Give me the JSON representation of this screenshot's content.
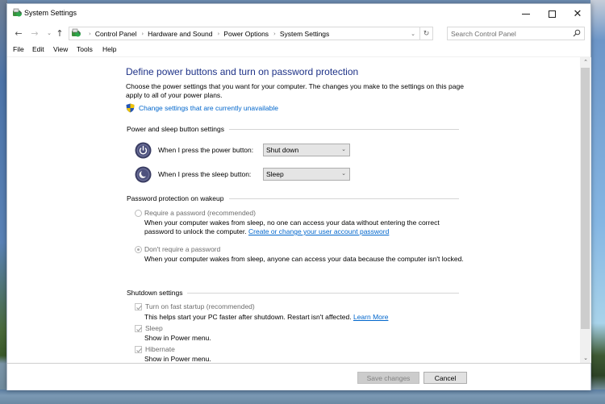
{
  "window": {
    "title": "System Settings",
    "controls": {
      "minimize": "minimize",
      "maximize": "maximize",
      "close": "close"
    }
  },
  "nav": {
    "breadcrumbs": [
      "Control Panel",
      "Hardware and Sound",
      "Power Options",
      "System Settings"
    ],
    "search_placeholder": "Search Control Panel",
    "search_value": ""
  },
  "menu": [
    "File",
    "Edit",
    "View",
    "Tools",
    "Help"
  ],
  "page": {
    "heading": "Define power buttons and turn on password protection",
    "intro": "Choose the power settings that you want for your computer. The changes you make to the settings on this page apply to all of your power plans.",
    "change_settings_link": "Change settings that are currently unavailable"
  },
  "power_section": {
    "title": "Power and sleep button settings",
    "rows": [
      {
        "label": "When I press the power button:",
        "value": "Shut down",
        "icon": "power-icon"
      },
      {
        "label": "When I press the sleep button:",
        "value": "Sleep",
        "icon": "sleep-moon-icon"
      }
    ]
  },
  "password_section": {
    "title": "Password protection on wakeup",
    "options": [
      {
        "label": "Require a password (recommended)",
        "checked": false,
        "description": "When your computer wakes from sleep, no one can access your data without entering the correct password to unlock the computer.",
        "link": "Create or change your user account password"
      },
      {
        "label": "Don't require a password",
        "checked": true,
        "description": "When your computer wakes from sleep, anyone can access your data because the computer isn't locked."
      }
    ]
  },
  "shutdown_section": {
    "title": "Shutdown settings",
    "items": [
      {
        "label": "Turn on fast startup (recommended)",
        "checked": true,
        "description": "This helps start your PC faster after shutdown. Restart isn't affected.",
        "link": "Learn More"
      },
      {
        "label": "Sleep",
        "checked": true,
        "description": "Show in Power menu."
      },
      {
        "label": "Hibernate",
        "checked": true,
        "description": "Show in Power menu."
      }
    ]
  },
  "footer": {
    "save_label": "Save changes",
    "cancel_label": "Cancel"
  },
  "colors": {
    "heading": "#1e3287",
    "link": "#0066cc",
    "disabled_text": "#6d6d6d"
  }
}
